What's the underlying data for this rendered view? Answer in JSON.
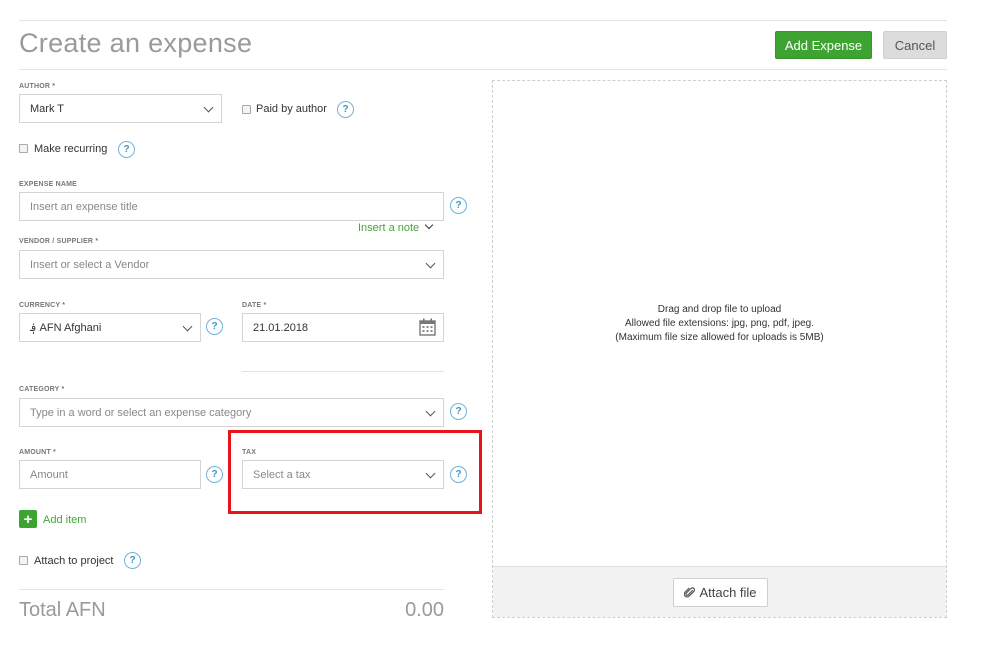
{
  "header": {
    "title": "Create an expense",
    "add_expense_label": "Add Expense",
    "cancel_label": "Cancel"
  },
  "author": {
    "label": "AUTHOR *",
    "value": "Mark T",
    "paid_by_author_label": "Paid by author",
    "paid_by_author_checked": false
  },
  "recurring": {
    "label": "Make recurring",
    "checked": false
  },
  "expense_name": {
    "label": "EXPENSE NAME",
    "placeholder": "Insert an expense title",
    "insert_note_label": "Insert a note"
  },
  "vendor": {
    "label": "VENDOR / SUPPLIER *",
    "placeholder": "Insert or select a Vendor"
  },
  "currency": {
    "label": "CURRENCY *",
    "value": "؋ AFN Afghani"
  },
  "date": {
    "label": "DATE *",
    "value": "21.01.2018"
  },
  "category": {
    "label": "CATEGORY *",
    "placeholder": "Type in a word or select an expense category"
  },
  "amount": {
    "label": "AMOUNT *",
    "placeholder": "Amount"
  },
  "tax": {
    "label": "TAX",
    "placeholder": "Select a tax"
  },
  "add_item_label": "Add item",
  "project": {
    "label": "Attach to project",
    "checked": false
  },
  "total": {
    "label": "Total AFN",
    "value": "0.00"
  },
  "upload": {
    "line1": "Drag and drop file to upload",
    "line2": "Allowed file extensions: jpg, png, pdf, jpeg.",
    "line3": "(Maximum file size allowed for uploads is 5MB)",
    "attach_label": "Attach file"
  },
  "help_glyph": "?",
  "icons": {
    "help": "question-circle-icon",
    "chevron": "chevron-down-icon",
    "calendar": "calendar-icon",
    "paperclip": "paperclip-icon",
    "plus": "plus-icon"
  },
  "colors": {
    "accent_green": "#3ea431",
    "help_blue": "#3a97c9",
    "highlight_red": "#e8131b",
    "title_grey": "#9a9a9a"
  }
}
